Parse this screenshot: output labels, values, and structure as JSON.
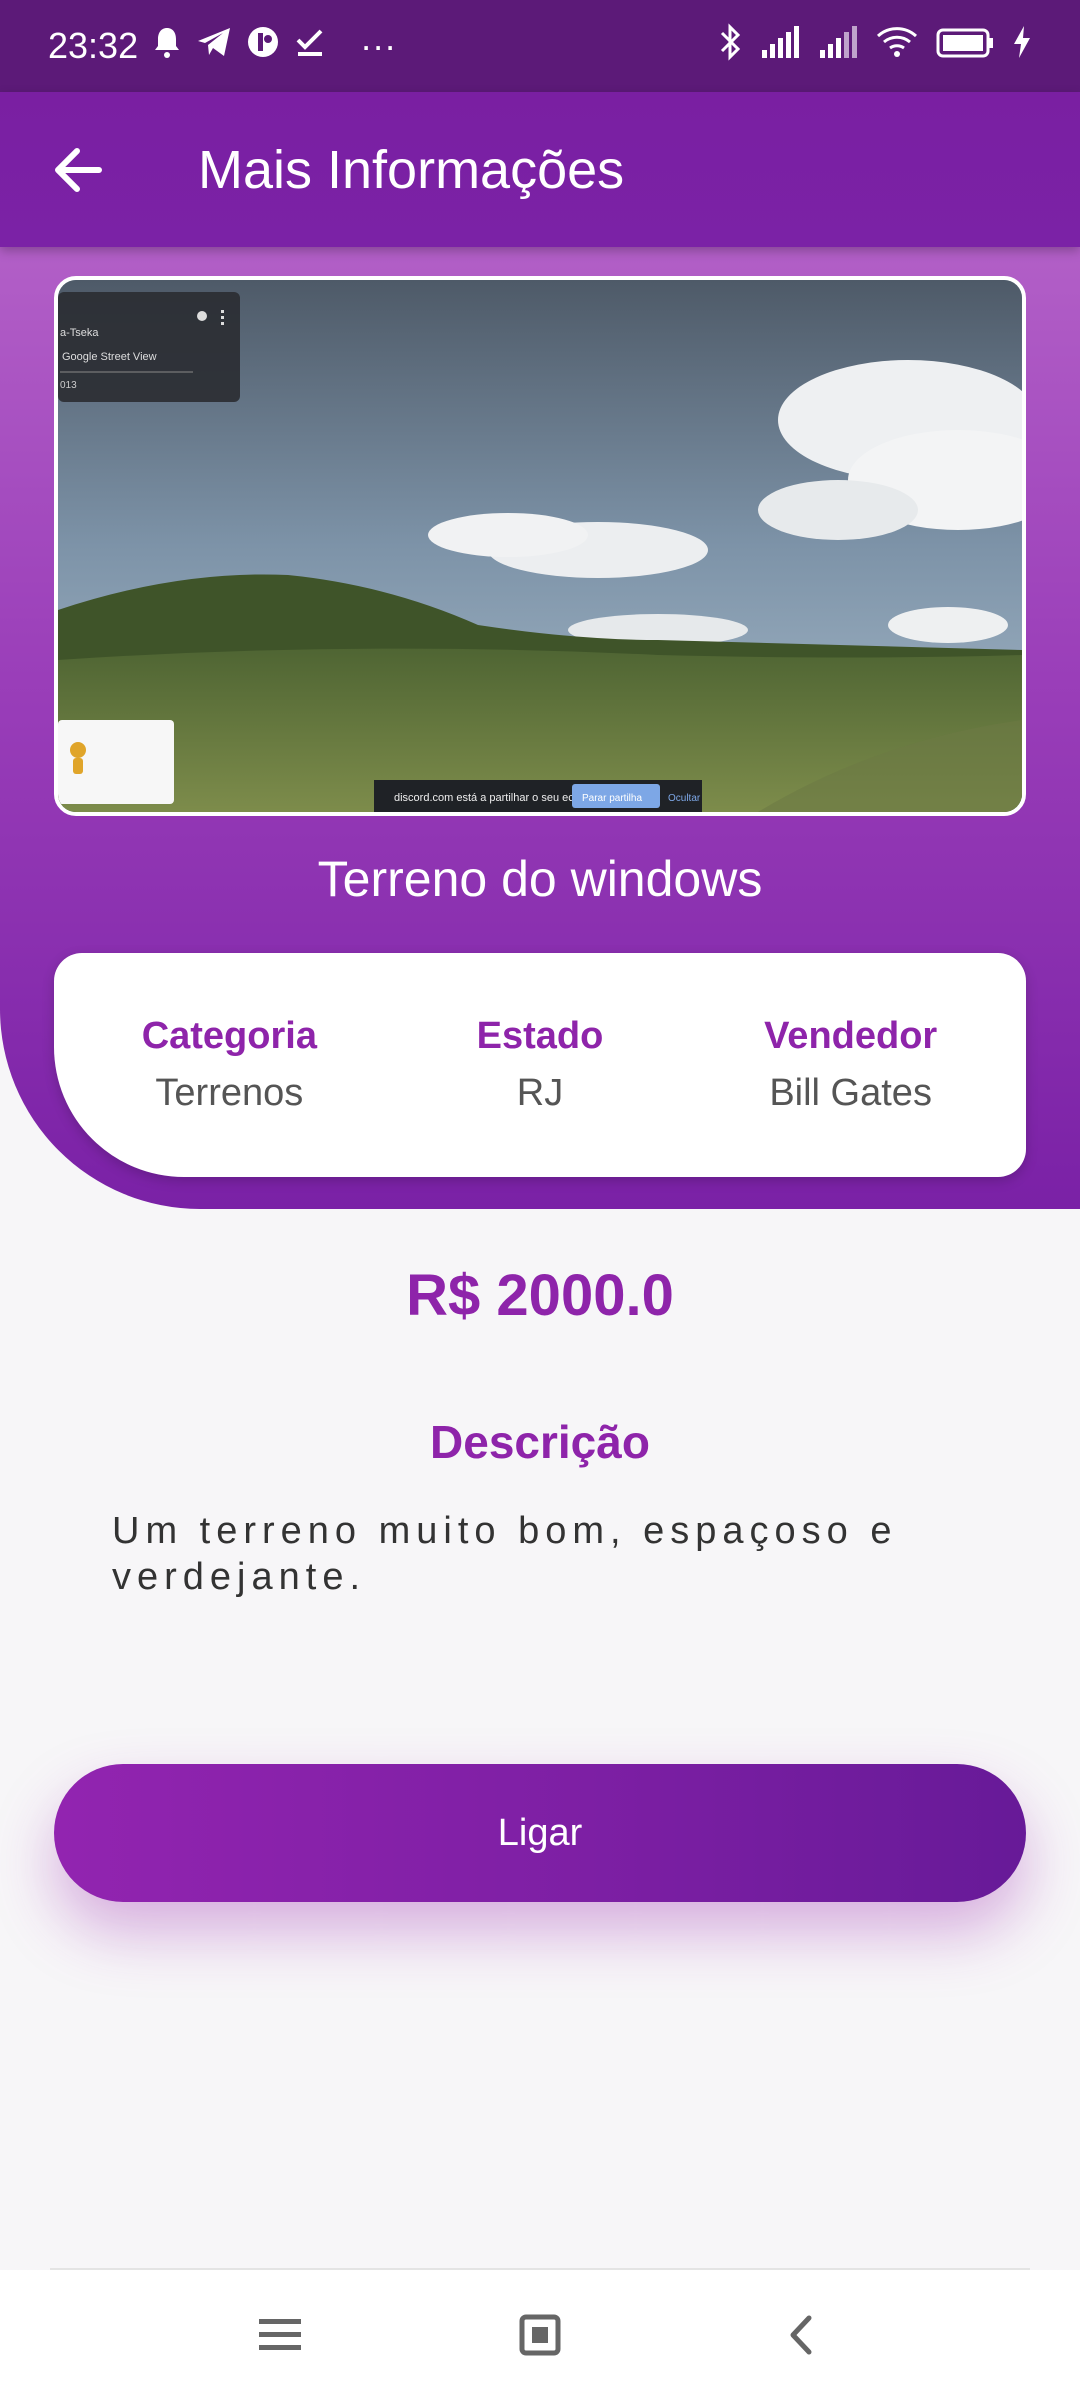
{
  "status_bar": {
    "time": "23:32",
    "more": "···",
    "icons": [
      "alarm-icon",
      "telegram-icon",
      "app-icon",
      "check-icon",
      "bluetooth-icon",
      "signal-icon",
      "signal-icon-2",
      "wifi-icon",
      "battery-icon",
      "charging-icon"
    ]
  },
  "app_bar": {
    "title": "Mais Informações",
    "back_icon": "arrow-left-icon"
  },
  "listing": {
    "title": "Terreno do windows",
    "photo_overlay": {
      "panel_line1": "a-Tseka",
      "panel_line2": "Google Street View",
      "panel_line3": "013",
      "share_text": "discord.com está a partilhar o seu ecrã.",
      "stop_label": "Parar partilha",
      "hide_label": "Ocultar"
    },
    "info": [
      {
        "label": "Categoria",
        "value": "Terrenos"
      },
      {
        "label": "Estado",
        "value": "RJ"
      },
      {
        "label": "Vendedor",
        "value": "Bill Gates"
      }
    ],
    "price": "R$ 2000.0",
    "description_title": "Descrição",
    "description": "Um terreno muito bom, espaçoso e verdejante."
  },
  "actions": {
    "call_label": "Ligar"
  },
  "nav_bar": {
    "icons": [
      "menu-icon",
      "home-icon",
      "back-icon"
    ]
  },
  "colors": {
    "accent": "#8e24aa",
    "status_bar": "#5c1a78",
    "app_bar": "#7a1fa2"
  }
}
